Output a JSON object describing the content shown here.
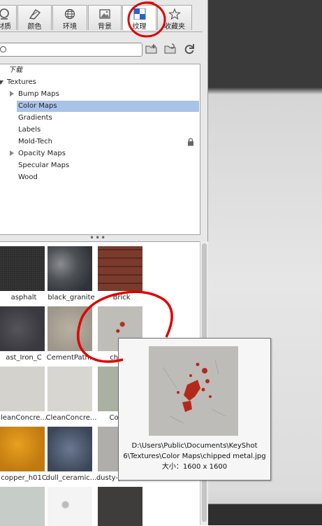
{
  "tabs": [
    {
      "icon": "material-ball-icon",
      "label": "材质"
    },
    {
      "icon": "color-swatch-icon",
      "label": "颜色"
    },
    {
      "icon": "globe-icon",
      "label": "环境"
    },
    {
      "icon": "image-icon",
      "label": "背景"
    },
    {
      "icon": "texture-checker-icon",
      "label": "纹理",
      "active": true
    },
    {
      "icon": "star-icon",
      "label": "收藏夹"
    }
  ],
  "search": {
    "placeholder": ""
  },
  "toolbar": {
    "icons": [
      "folder-add-icon",
      "folder-refresh-icon",
      "refresh-icon"
    ]
  },
  "tree": {
    "rows": [
      {
        "label": "下载"
      },
      {
        "label": "Textures"
      },
      {
        "label": "Bump Maps"
      },
      {
        "label": "Color Maps"
      },
      {
        "label": "Gradients"
      },
      {
        "label": "Labels"
      },
      {
        "label": "Mold-Tech"
      },
      {
        "label": "Opacity Maps"
      },
      {
        "label": "Specular Maps"
      },
      {
        "label": "Wood"
      }
    ]
  },
  "thumbnails": [
    {
      "label": "asphalt"
    },
    {
      "label": "black_granite"
    },
    {
      "label": "Brick"
    },
    {
      "label": "ast_Iron_C"
    },
    {
      "label": "CementPath..."
    },
    {
      "label": "chippe"
    },
    {
      "label": "leanConcre..."
    },
    {
      "label": "CleanConcre..."
    },
    {
      "label": "Concre"
    },
    {
      "label": "copper_h01C"
    },
    {
      "label": "dull_ceramic..."
    },
    {
      "label": "dusty-painte..."
    },
    {
      "label": ""
    },
    {
      "label": ""
    },
    {
      "label": ""
    }
  ],
  "tooltip": {
    "path_line1": "D:\\Users\\Public\\Documents\\KeyShot",
    "path_line2": "6\\Textures\\Color Maps\\chipped metal.jpg",
    "size": "大小：1600 x 1600"
  },
  "colors": {
    "selection": "#a9c3e8",
    "annotation": "#e00000"
  }
}
